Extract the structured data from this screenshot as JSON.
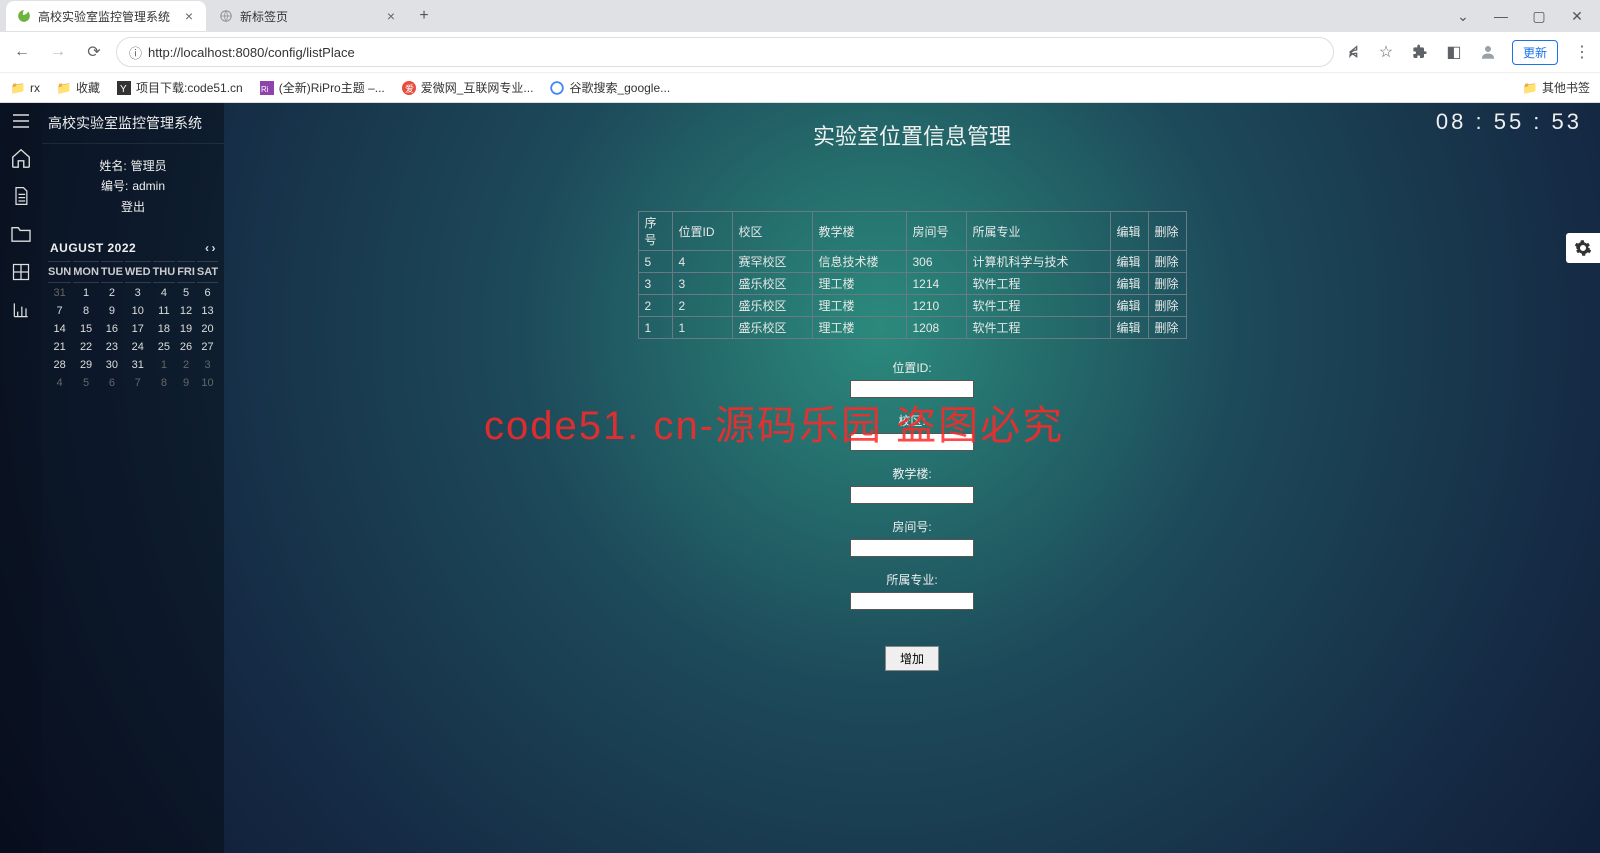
{
  "browser": {
    "tabs": [
      {
        "title": "高校实验室监控管理系统",
        "active": true
      },
      {
        "title": "新标签页",
        "active": false
      }
    ],
    "url": "http://localhost:8080/config/listPlace",
    "update_label": "更新",
    "bookmarks": [
      {
        "label": "rx"
      },
      {
        "label": "收藏"
      },
      {
        "label": "项目下载:code51.cn"
      },
      {
        "label": "(全新)RiPro主题 –..."
      },
      {
        "label": "爱微网_互联网专业..."
      },
      {
        "label": "谷歌搜索_google..."
      }
    ],
    "other_bookmarks": "其他书签"
  },
  "app": {
    "title": "高校实验室监控管理系统",
    "clock": "08 : 55 : 53",
    "user": {
      "name_label": "姓名:",
      "name_value": "管理员",
      "id_label": "编号:",
      "id_value": "admin",
      "logout": "登出"
    },
    "calendar": {
      "month": "AUGUST 2022",
      "dow": [
        "SUN",
        "MON",
        "TUE",
        "WED",
        "THU",
        "FRI",
        "SAT"
      ],
      "weeks": [
        [
          {
            "d": "31",
            "m": true
          },
          {
            "d": "1"
          },
          {
            "d": "2"
          },
          {
            "d": "3"
          },
          {
            "d": "4"
          },
          {
            "d": "5"
          },
          {
            "d": "6"
          }
        ],
        [
          {
            "d": "7"
          },
          {
            "d": "8"
          },
          {
            "d": "9"
          },
          {
            "d": "10"
          },
          {
            "d": "11"
          },
          {
            "d": "12"
          },
          {
            "d": "13"
          }
        ],
        [
          {
            "d": "14"
          },
          {
            "d": "15"
          },
          {
            "d": "16"
          },
          {
            "d": "17"
          },
          {
            "d": "18"
          },
          {
            "d": "19"
          },
          {
            "d": "20"
          }
        ],
        [
          {
            "d": "21"
          },
          {
            "d": "22"
          },
          {
            "d": "23"
          },
          {
            "d": "24"
          },
          {
            "d": "25"
          },
          {
            "d": "26"
          },
          {
            "d": "27"
          }
        ],
        [
          {
            "d": "28"
          },
          {
            "d": "29"
          },
          {
            "d": "30"
          },
          {
            "d": "31"
          },
          {
            "d": "1",
            "m": true
          },
          {
            "d": "2",
            "m": true
          },
          {
            "d": "3",
            "m": true
          }
        ],
        [
          {
            "d": "4",
            "m": true
          },
          {
            "d": "5",
            "m": true
          },
          {
            "d": "6",
            "m": true
          },
          {
            "d": "7",
            "m": true
          },
          {
            "d": "8",
            "m": true
          },
          {
            "d": "9",
            "m": true
          },
          {
            "d": "10",
            "m": true
          }
        ]
      ]
    },
    "page_title": "实验室位置信息管理",
    "table": {
      "headers": [
        "序号",
        "位置ID",
        "校区",
        "教学楼",
        "房间号",
        "所属专业",
        "编辑",
        "删除"
      ],
      "rows": [
        {
          "idx": "5",
          "id": "4",
          "campus": "赛罕校区",
          "bldg": "信息技术楼",
          "room": "306",
          "major": "计算机科学与技术",
          "edit": "编辑",
          "del": "删除"
        },
        {
          "idx": "3",
          "id": "3",
          "campus": "盛乐校区",
          "bldg": "理工楼",
          "room": "1214",
          "major": "软件工程",
          "edit": "编辑",
          "del": "删除"
        },
        {
          "idx": "2",
          "id": "2",
          "campus": "盛乐校区",
          "bldg": "理工楼",
          "room": "1210",
          "major": "软件工程",
          "edit": "编辑",
          "del": "删除"
        },
        {
          "idx": "1",
          "id": "1",
          "campus": "盛乐校区",
          "bldg": "理工楼",
          "room": "1208",
          "major": "软件工程",
          "edit": "编辑",
          "del": "删除"
        }
      ]
    },
    "form": {
      "fields": [
        {
          "label": "位置ID:"
        },
        {
          "label": "校区:"
        },
        {
          "label": "教学楼:"
        },
        {
          "label": "房间号:"
        },
        {
          "label": "所属专业:"
        }
      ],
      "submit": "增加"
    },
    "watermark": "code51. cn-源码乐园 盗图必究"
  }
}
